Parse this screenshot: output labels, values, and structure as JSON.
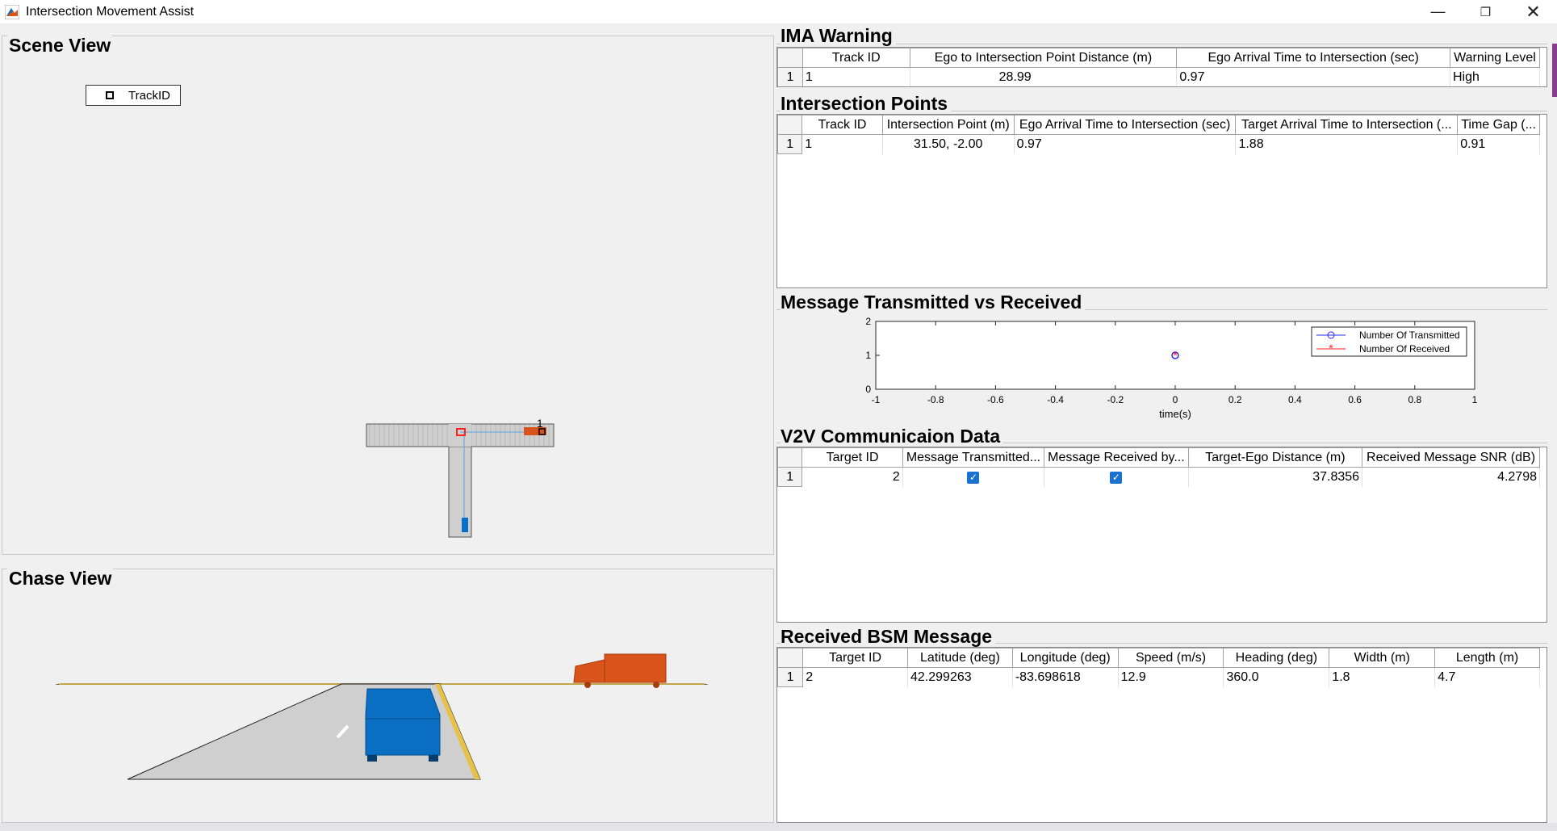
{
  "window": {
    "title": "Intersection Movement Assist"
  },
  "scene_view": {
    "title": "Scene View",
    "legend_label": "TrackID",
    "track_marker_label": "1"
  },
  "chase_view": {
    "title": "Chase View"
  },
  "ima_warning": {
    "title": "IMA Warning",
    "columns": [
      "Track ID",
      "Ego to Intersection Point Distance (m)",
      "Ego Arrival Time to Intersection (sec)",
      "Warning Level"
    ],
    "rows": [
      {
        "index": "1",
        "cells": [
          "1",
          "28.99",
          "0.97",
          "High"
        ]
      }
    ]
  },
  "intersection_points": {
    "title": "Intersection Points",
    "columns": [
      "Track ID",
      "Intersection Point (m)",
      "Ego Arrival Time to Intersection (sec)",
      "Target Arrival Time to Intersection (...",
      "Time Gap (..."
    ],
    "rows": [
      {
        "index": "1",
        "cells": [
          "1",
          "31.50, -2.00",
          "0.97",
          "1.88",
          "0.91"
        ]
      }
    ]
  },
  "message_chart": {
    "title": "Message Transmitted vs Received"
  },
  "chart_data": {
    "type": "scatter",
    "title": "",
    "xlabel": "time(s)",
    "ylabel": "",
    "xlim": [
      -1,
      1
    ],
    "ylim": [
      0,
      2
    ],
    "x_ticks": [
      "-1",
      "-0.8",
      "-0.6",
      "-0.4",
      "-0.2",
      "0",
      "0.2",
      "0.4",
      "0.6",
      "0.8",
      "1"
    ],
    "y_ticks": [
      "0",
      "1",
      "2"
    ],
    "legend_position": "top-right",
    "series": [
      {
        "name": "Number Of Transmitted",
        "color": "#2a2aff",
        "marker": "circle",
        "x": [
          0
        ],
        "y": [
          1
        ]
      },
      {
        "name": "Number Of Received",
        "color": "#ff2020",
        "marker": "asterisk",
        "x": [
          0
        ],
        "y": [
          1
        ]
      }
    ]
  },
  "v2v_data": {
    "title": "V2V Communicaion Data",
    "columns": [
      "Target ID",
      "Message Transmitted...",
      "Message Received by...",
      "Target-Ego Distance (m)",
      "Received Message SNR (dB)"
    ],
    "rows": [
      {
        "index": "1",
        "target_id": "2",
        "transmitted_checked": true,
        "received_checked": true,
        "distance": "37.8356",
        "snr": "4.2798"
      }
    ]
  },
  "bsm_message": {
    "title": "Received BSM Message",
    "columns": [
      "Target ID",
      "Latitude (deg)",
      "Longitude (deg)",
      "Speed (m/s)",
      "Heading (deg)",
      "Width (m)",
      "Length (m)"
    ],
    "rows": [
      {
        "index": "1",
        "cells": [
          "2",
          "42.299263",
          "-83.698618",
          "12.9",
          "360.0",
          "1.8",
          "4.7"
        ]
      }
    ]
  },
  "colors": {
    "ego_vehicle": "#0a6fc2",
    "target_vehicle": "#d9541a",
    "road": "#cfcfcf",
    "panel_bg": "#f0f0f0"
  }
}
